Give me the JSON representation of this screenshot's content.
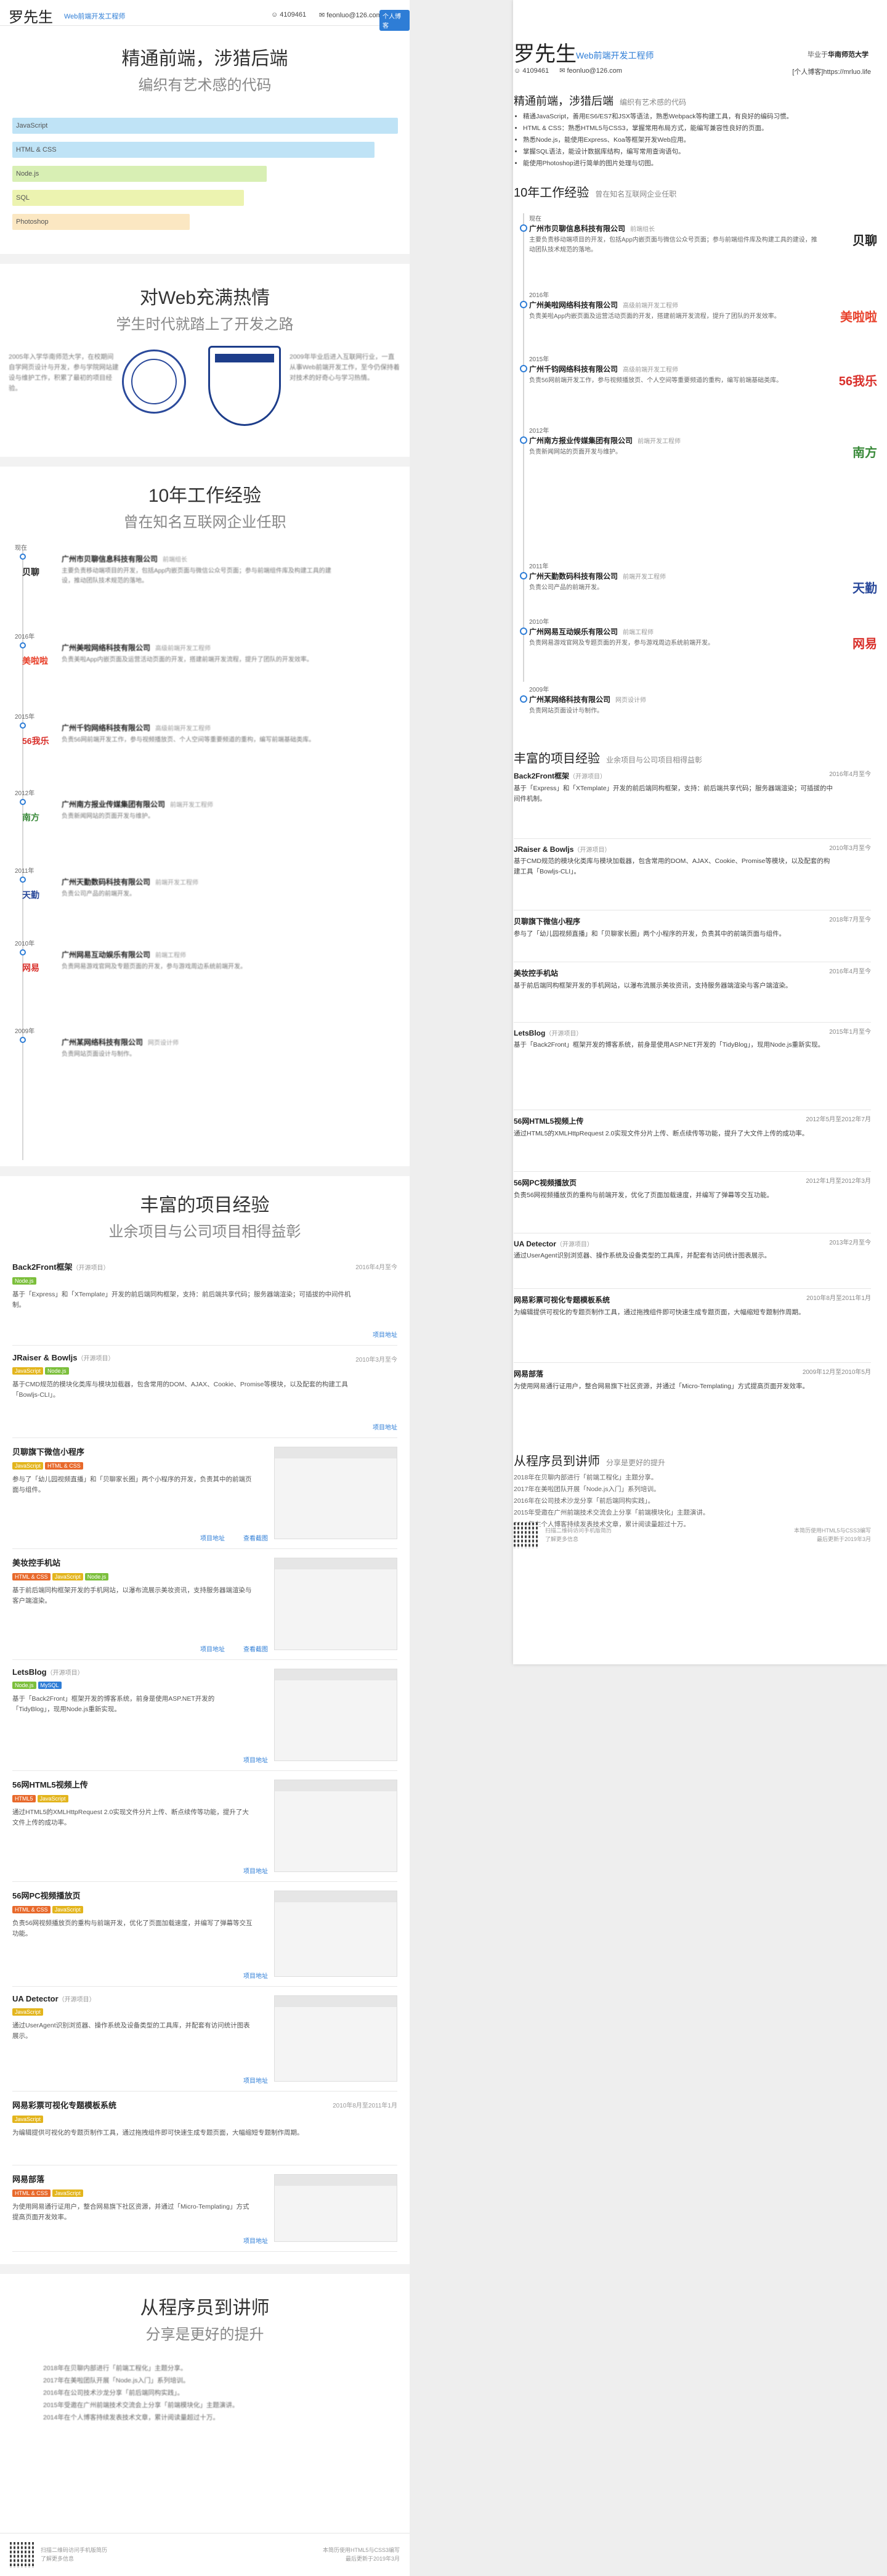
{
  "person": {
    "name": "罗先生",
    "role": "Web前端开发工程师",
    "qq": "4109461",
    "email": "feonluo@126.com",
    "badge": "个人博客",
    "school_prefix": "毕业于",
    "school": "华南师范大学",
    "blog": "[个人博客]https://mrluo.life"
  },
  "hero": {
    "title": "精通前端，涉猎后端",
    "subtitle": "编织有艺术感的代码"
  },
  "skills": [
    {
      "label": "JavaScript",
      "level": 1.0,
      "color": "#bfe3f6"
    },
    {
      "label": "HTML & CSS",
      "level": 0.94,
      "color": "#bfe3f6"
    },
    {
      "label": "Node.js",
      "level": 0.66,
      "color": "#d8efb4"
    },
    {
      "label": "SQL",
      "level": 0.6,
      "color": "#ecf3b0"
    },
    {
      "label": "Photoshop",
      "level": 0.46,
      "color": "#fbe7c2"
    }
  ],
  "skill_points": [
    "精通JavaScript，善用ES6/ES7和JSX等语法，熟悉Webpack等构建工具，有良好的编码习惯。",
    "HTML & CSS：熟悉HTML5与CSS3，掌握常用布局方式，能编写兼容性良好的页面。",
    "熟悉Node.js，能使用Express、Koa等框架开发Web应用。",
    "掌握SQL语法，能设计数据库结构，编写常用查询语句。",
    "能使用Photoshop进行简单的图片处理与切图。"
  ],
  "passion": {
    "title": "对Web充满热情",
    "subtitle": "学生时代就踏上了开发之路",
    "left_text": "2005年入学华南师范大学，在校期间自学网页设计与开发，参与学院网站建设与维护工作，积累了最初的项目经验。",
    "right_text": "2009年毕业后进入互联网行业，一直从事Web前端开发工作，至今仍保持着对技术的好奇心与学习热情。"
  },
  "exp_section": {
    "title": "10年工作经验",
    "subtitle": "曾在知名互联网企业任职"
  },
  "jobs": [
    {
      "year": "现在",
      "company": "广州市贝聊信息科技有限公司",
      "position": "前端组长",
      "desc": "主要负责移动端项目的开发，包括App内嵌页面与微信公众号页面；参与前端组件库及构建工具的建设，推动团队技术规范的落地。",
      "logo": "贝聊",
      "logo_color": "#222222"
    },
    {
      "year": "2016年",
      "company": "广州美啦网络科技有限公司",
      "position": "高级前端开发工程师",
      "desc": "负责美啦App内嵌页面及运营活动页面的开发，搭建前端开发流程，提升了团队的开发效率。",
      "logo": "美啦啦",
      "logo_color": "#e8412b"
    },
    {
      "year": "2015年",
      "company": "广州千钧网络科技有限公司",
      "position": "高级前端开发工程师",
      "desc": "负责56网前端开发工作，参与视频播放页、个人空间等重要频道的重构，编写前端基础类库。",
      "logo": "56我乐",
      "logo_color": "#d9302b"
    },
    {
      "year": "2012年",
      "company": "广州南方报业传媒集团有限公司",
      "position": "前端开发工程师",
      "desc": "负责新闻网站的页面开发与维护。",
      "logo": "南方",
      "logo_color": "#3a8a3a"
    },
    {
      "year": "2011年",
      "company": "广州天勤数码科技有限公司",
      "position": "前端开发工程师",
      "desc": "负责公司产品的前端开发。",
      "logo": "天勤",
      "logo_color": "#2b4a9b"
    },
    {
      "year": "2010年",
      "company": "广州网易互动娱乐有限公司",
      "position": "前端工程师",
      "desc": "负责网易游戏官网及专题页面的开发，参与游戏周边系统前端开发。",
      "logo": "网易",
      "logo_color": "#d9302b"
    },
    {
      "year": "2009年",
      "company": "广州某网络科技有限公司",
      "position": "网页设计师",
      "desc": "负责网站页面设计与制作。",
      "logo": "",
      "logo_color": "#2e7dd6"
    }
  ],
  "proj_section": {
    "title": "丰富的项目经验",
    "subtitle": "业余项目与公司项目相得益彰"
  },
  "projects": [
    {
      "title": "Back2Front框架",
      "note": "（开源项目）",
      "date": "2016年4月至今",
      "tags": [
        "Node.js"
      ],
      "desc": "基于「Express」和「XTemplate」开发的前后端同构框架，支持：前后端共享代码；服务器端渲染；可插拔的中间件机制。",
      "links": [
        "项目地址"
      ]
    },
    {
      "title": "JRaiser & Bowljs",
      "note": "（开源项目）",
      "date": "2010年3月至今",
      "tags": [
        "JavaScript",
        "Node.js"
      ],
      "desc": "基于CMD规范的模块化类库与模块加载器，包含常用的DOM、AJAX、Cookie、Promise等模块，以及配套的构建工具「Bowljs-CLI」。",
      "links": [
        "项目地址"
      ]
    },
    {
      "title": "贝聊旗下微信小程序",
      "note": "",
      "date": "2018年7月至今",
      "tags": [
        "JavaScript",
        "HTML & CSS"
      ],
      "desc": "参与了「幼儿园视频直播」和「贝聊家长圈」两个小程序的开发，负责其中的前端页面与组件。",
      "links": [
        "项目地址",
        "查看截图"
      ]
    },
    {
      "title": "美妆控手机站",
      "note": "",
      "date": "2016年4月至今",
      "tags": [
        "HTML & CSS",
        "JavaScript",
        "Node.js"
      ],
      "desc": "基于前后端同构框架开发的手机网站，以瀑布流展示美妆资讯，支持服务器端渲染与客户端渲染。",
      "links": [
        "项目地址",
        "查看截图"
      ]
    },
    {
      "title": "LetsBlog",
      "note": "（开源项目）",
      "date": "2015年1月至今",
      "tags": [
        "Node.js",
        "MySQL"
      ],
      "desc": "基于「Back2Front」框架开发的博客系统，前身是使用ASP.NET开发的「TidyBlog」，现用Node.js重新实现。",
      "links": [
        "项目地址"
      ]
    },
    {
      "title": "56网HTML5视频上传",
      "note": "",
      "date": "2012年5月至2012年7月",
      "tags": [
        "HTML5",
        "JavaScript"
      ],
      "desc": "通过HTML5的XMLHttpRequest 2.0实现文件分片上传、断点续传等功能，提升了大文件上传的成功率。",
      "links": [
        "项目地址"
      ]
    },
    {
      "title": "56网PC视频播放页",
      "note": "",
      "date": "2012年1月至2012年3月",
      "tags": [
        "HTML & CSS",
        "JavaScript"
      ],
      "desc": "负责56网视频播放页的重构与前端开发，优化了页面加载速度，并编写了弹幕等交互功能。",
      "links": [
        "项目地址"
      ]
    },
    {
      "title": "UA Detector",
      "note": "（开源项目）",
      "date": "2013年2月至今",
      "tags": [
        "JavaScript"
      ],
      "desc": "通过UserAgent识别浏览器、操作系统及设备类型的工具库，并配套有访问统计图表展示。",
      "links": [
        "项目地址"
      ]
    },
    {
      "title": "网易彩票可视化专题模板系统",
      "note": "",
      "date": "2010年8月至2011年1月",
      "tags": [
        "JavaScript"
      ],
      "desc": "为编辑提供可视化的专题页制作工具，通过拖拽组件即可快速生成专题页面，大幅缩短专题制作周期。",
      "links": []
    },
    {
      "title": "网易部落",
      "note": "",
      "date": "2009年12月至2010年5月",
      "tags": [
        "HTML & CSS",
        "JavaScript"
      ],
      "desc": "为使用网易通行证用户，整合网易旗下社区资源，并通过「Micro-Templating」方式提高页面开发效率。",
      "links": [
        "项目地址"
      ]
    }
  ],
  "talk_section": {
    "title": "从程序员到讲师",
    "subtitle": "分享是更好的提升"
  },
  "talks": [
    "2018年在贝聊内部进行「前端工程化」主题分享。",
    "2017年在美啦团队开展「Node.js入门」系列培训。",
    "2016年在公司技术沙龙分享「前后端同构实践」。",
    "2015年受邀在广州前端技术交流会上分享「前端模块化」主题演讲。",
    "2014年在个人博客持续发表技术文章，累计阅读量超过十万。"
  ],
  "footer": {
    "qr_note_1": "扫描二维码访问手机版简历",
    "qr_note_2": "了解更多信息",
    "copy_1": "本简历使用HTML5与CSS3编写",
    "copy_2": "最后更新于2019年3月"
  }
}
